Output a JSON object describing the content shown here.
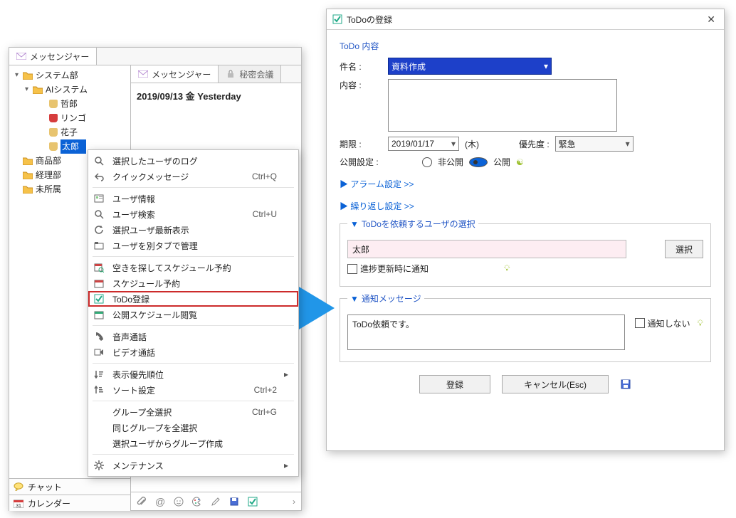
{
  "left_window": {
    "tabs": {
      "messenger": "メッセンジャー",
      "secret": "秘密会議"
    },
    "tree_root": "システム部",
    "tree_child": "AIシステム",
    "users": {
      "u0": "哲郎",
      "u1": "リンゴ",
      "u2": "花子",
      "u3": "太郎"
    },
    "folders": {
      "f0": "商品部",
      "f1": "経理部",
      "f2": "未所属"
    },
    "side_tabs": {
      "chat": "チャット",
      "calendar": "カレンダー"
    },
    "date_header": "2019/09/13 金 Yesterday"
  },
  "context_menu": {
    "items": [
      {
        "icon": "search-icon",
        "label": "選択したユーザのログ",
        "shortcut": "",
        "arrow": false
      },
      {
        "icon": "reply-icon",
        "label": "クイックメッセージ",
        "shortcut": "Ctrl+Q",
        "arrow": false
      },
      "-",
      {
        "icon": "card-icon",
        "label": "ユーザ情報",
        "shortcut": "",
        "arrow": false
      },
      {
        "icon": "search-icon",
        "label": "ユーザ検索",
        "shortcut": "Ctrl+U",
        "arrow": false
      },
      {
        "icon": "refresh-icon",
        "label": "選択ユーザ最新表示",
        "shortcut": "",
        "arrow": false
      },
      {
        "icon": "tab-icon",
        "label": "ユーザを別タブで管理",
        "shortcut": "",
        "arrow": false
      },
      "-",
      {
        "icon": "calendar-search-icon",
        "label": "空きを探してスケジュール予約",
        "shortcut": "",
        "arrow": false
      },
      {
        "icon": "calendar-icon",
        "label": "スケジュール予約",
        "shortcut": "",
        "arrow": false
      },
      {
        "icon": "check-icon",
        "label": "ToDo登録",
        "shortcut": "",
        "arrow": false,
        "highlight": true
      },
      {
        "icon": "calendar-open-icon",
        "label": "公開スケジュール閲覧",
        "shortcut": "",
        "arrow": false
      },
      "-",
      {
        "icon": "phone-icon",
        "label": "音声通話",
        "shortcut": "",
        "arrow": false
      },
      {
        "icon": "video-icon",
        "label": "ビデオ通話",
        "shortcut": "",
        "arrow": false
      },
      "-",
      {
        "icon": "sort-icon",
        "label": "表示優先順位",
        "shortcut": "",
        "arrow": true
      },
      {
        "icon": "sort2-icon",
        "label": "ソート設定",
        "shortcut": "Ctrl+2",
        "arrow": false
      },
      "-",
      {
        "icon": "",
        "label": "グループ全選択",
        "shortcut": "Ctrl+G",
        "arrow": false
      },
      {
        "icon": "",
        "label": "同じグループを全選択",
        "shortcut": "",
        "arrow": false
      },
      {
        "icon": "",
        "label": "選択ユーザからグループ作成",
        "shortcut": "",
        "arrow": false
      },
      "-",
      {
        "icon": "gear-icon",
        "label": "メンテナンス",
        "shortcut": "",
        "arrow": true
      }
    ]
  },
  "dialog": {
    "title": "ToDoの登録",
    "group_content": "ToDo 内容",
    "labels": {
      "subject": "件名 :",
      "content": "内容 :",
      "deadline": "期限 :",
      "dow": "(木)",
      "priority": "優先度 :",
      "visibility": "公開設定 :",
      "private": "非公開",
      "public": "公開"
    },
    "subject_value": "資料作成",
    "deadline_value": "2019/01/17",
    "priority_value": "緊急",
    "links": {
      "alarm": "アラーム設定 >>",
      "repeat": "繰り返し設定 >>"
    },
    "user_section": {
      "legend": "ToDoを依頼するユーザの選択",
      "user": "太郎",
      "select_btn": "選択",
      "notify_on_progress": "進捗更新時に通知"
    },
    "msg_section": {
      "legend": "通知メッセージ",
      "text": "ToDo依頼です。",
      "no_notify": "通知しない"
    },
    "footer": {
      "register": "登録",
      "cancel": "キャンセル(Esc)"
    }
  }
}
